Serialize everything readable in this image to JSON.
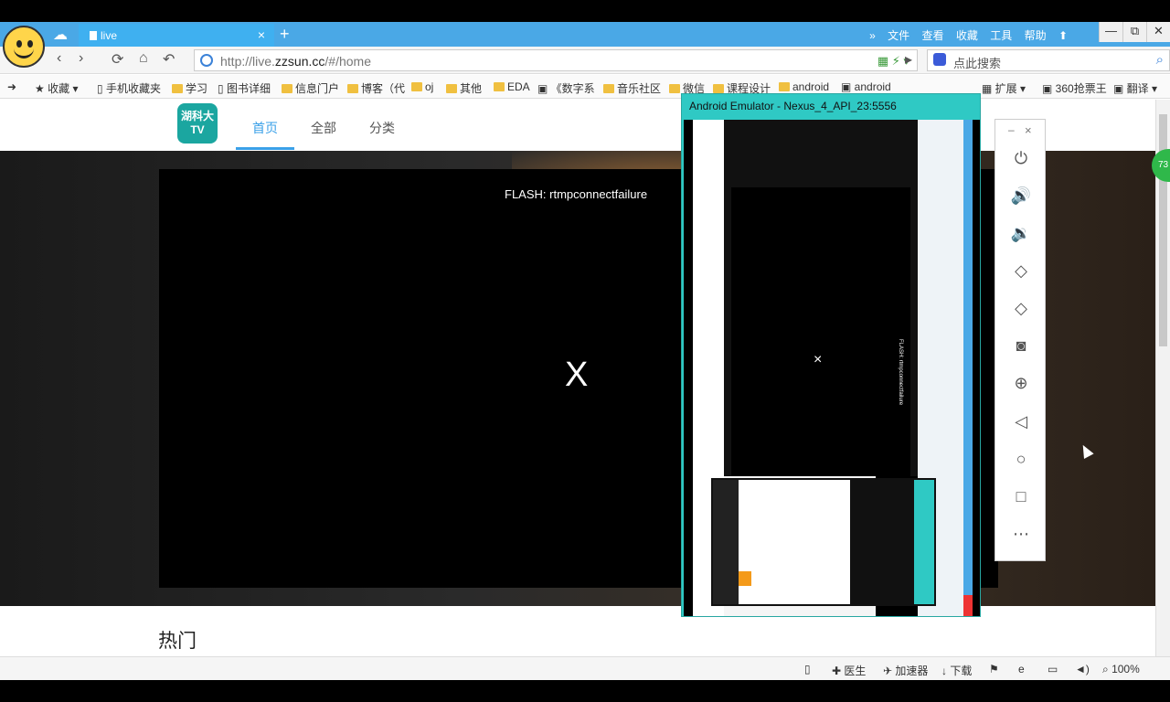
{
  "browser": {
    "tab_label": "live",
    "tab_close": "×",
    "new_tab": "+",
    "menu": [
      "»",
      "文件",
      "查看",
      "收藏",
      "工具",
      "帮助"
    ],
    "win_buttons": [
      "—",
      "⧉",
      "✕"
    ],
    "url_prefix": "http://live.",
    "url_domain": "zzsun.cc",
    "url_suffix": "/#/home",
    "search_placeholder": "点此搜索",
    "bookmarks": [
      "收藏",
      "手机收藏夹",
      "学习",
      "图书详细",
      "信息门户",
      "博客（代",
      "oj",
      "其他",
      "EDA",
      "《数字系",
      "音乐社区",
      "微信",
      "课程设计",
      "android",
      "android",
      "扩展",
      "360抢票王",
      "翻译"
    ],
    "status": [
      "医生",
      "加速器",
      "下载",
      "100%"
    ]
  },
  "site": {
    "logo_line1": "湖科大",
    "logo_line2": "TV",
    "nav": [
      "首页",
      "全部",
      "分类"
    ],
    "flash_message": "FLASH: rtmpconnectfailure",
    "player_close": "X",
    "hot_title": "热门",
    "badge": "73"
  },
  "emulator": {
    "title": "Android Emulator - Nexus_4_API_23:5556",
    "close_x": "×",
    "flash_message": "FLASH: rtmpconnectfailure"
  },
  "emu_panel": {
    "minimize": "–",
    "close": "×",
    "icons": [
      "power-icon",
      "volume-up-icon",
      "volume-down-icon",
      "rotate-left-icon",
      "rotate-right-icon",
      "camera-icon",
      "zoom-icon",
      "back-icon",
      "home-icon",
      "overview-icon",
      "more-icon"
    ]
  },
  "colors": {
    "tab_bar": "#4aa8e6",
    "accent": "#3aa0e8",
    "logo": "#1ba6a0",
    "emulator_frame": "#2fc9c4"
  }
}
